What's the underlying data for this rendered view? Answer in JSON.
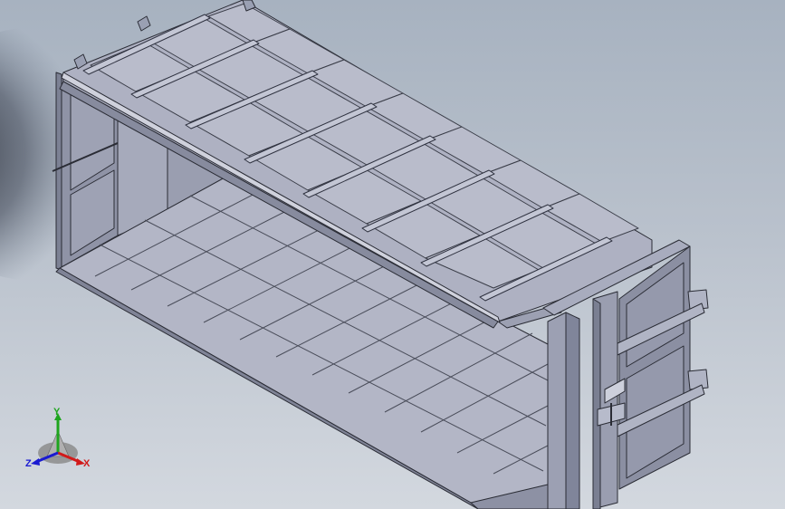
{
  "viewport": {
    "background_top": "#a7b2c0",
    "background_bottom": "#d3d8df",
    "model_face_light": "#b4b7c6",
    "model_face_mid": "#9fa3b4",
    "model_face_dark": "#858a9c",
    "edge_color": "#2a2c35"
  },
  "triad": {
    "x_label": "X",
    "y_label": "Y",
    "z_label": "Z",
    "x_color": "#d11a1a",
    "y_color": "#1ea51e",
    "z_color": "#1a1ad1"
  }
}
